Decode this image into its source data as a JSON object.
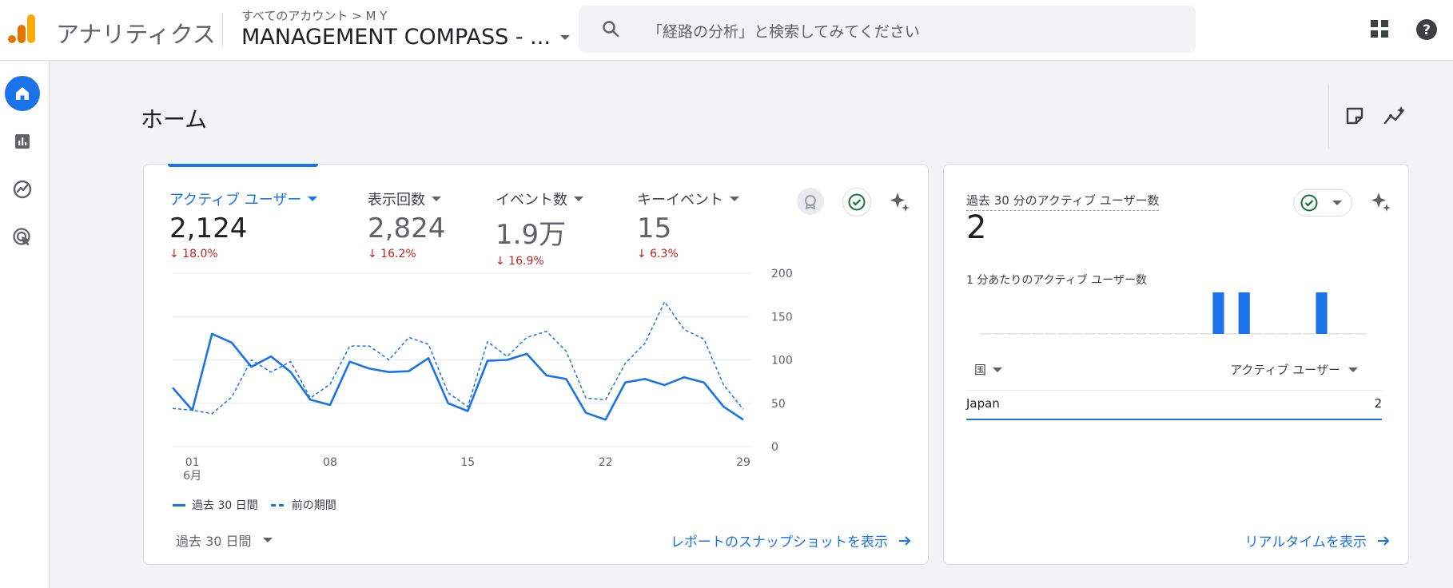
{
  "app": {
    "name": "アナリティクス"
  },
  "header": {
    "breadcrumb": "すべてのアカウント > M Y",
    "property": "MANAGEMENT COMPASS - ...",
    "search_placeholder": "「経路の分析」と検索してみてください"
  },
  "rail": {
    "items": [
      "home-icon",
      "reports-icon",
      "explore-icon",
      "advertising-icon"
    ]
  },
  "page": {
    "title": "ホーム"
  },
  "summary": {
    "metrics": [
      {
        "label": "アクティブ ユーザー",
        "value": "2,124",
        "change": "↓ 18.0%"
      },
      {
        "label": "表示回数",
        "value": "2,824",
        "change": "↓ 16.2%"
      },
      {
        "label": "イベント数",
        "value": "1.9万",
        "change": "↓ 16.9%"
      },
      {
        "label": "キーイベント",
        "value": "15",
        "change": "↓ 6.3%"
      }
    ],
    "legend_current": "過去 30 日間",
    "legend_previous": "前の期間",
    "period": "過去 30 日間",
    "snapshot_link": "レポートのスナップショットを表示"
  },
  "chart_data": {
    "type": "line",
    "x_ticks": [
      {
        "day": 1,
        "label": "01"
      },
      {
        "day": 8,
        "label": "08"
      },
      {
        "day": 15,
        "label": "15"
      },
      {
        "day": 22,
        "label": "22"
      },
      {
        "day": 29,
        "label": "29"
      }
    ],
    "x_month_label": "6月",
    "ylim": [
      0,
      200
    ],
    "y_ticks": [
      0,
      50,
      100,
      150,
      200
    ],
    "series": [
      {
        "name": "過去 30 日間",
        "style": "solid",
        "x": [
          0,
          1,
          2,
          3,
          4,
          5,
          6,
          7,
          8,
          9,
          10,
          11,
          12,
          13,
          14,
          15,
          16,
          17,
          18,
          19,
          20,
          21,
          22,
          23,
          24,
          25,
          26,
          27,
          28,
          29
        ],
        "values": [
          68,
          42,
          130,
          120,
          92,
          104,
          86,
          54,
          48,
          98,
          90,
          86,
          87,
          102,
          50,
          41,
          99,
          100,
          107,
          82,
          78,
          39,
          31,
          74,
          78,
          71,
          80,
          74,
          46,
          31
        ]
      },
      {
        "name": "前の期間",
        "style": "dashed",
        "x": [
          0,
          1,
          2,
          3,
          4,
          5,
          6,
          7,
          8,
          9,
          10,
          11,
          12,
          13,
          14,
          15,
          16,
          17,
          18,
          19,
          20,
          21,
          22,
          23,
          24,
          25,
          26,
          27,
          28,
          29
        ],
        "values": [
          44,
          42,
          38,
          57,
          100,
          86,
          98,
          56,
          72,
          116,
          116,
          100,
          126,
          118,
          62,
          46,
          121,
          104,
          126,
          133,
          110,
          56,
          54,
          96,
          119,
          167,
          135,
          124,
          71,
          43
        ]
      }
    ],
    "colors": {
      "line": "#1a73e8",
      "grid": "#e8eaed"
    }
  },
  "realtime": {
    "title": "過去 30 分のアクティブ ユーザー数",
    "value": "2",
    "sub": "1 分あたりのアクティブ ユーザー数",
    "minute_bars": [
      0,
      0,
      0,
      0,
      0,
      0,
      0,
      0,
      0,
      0,
      0,
      0,
      0,
      0,
      0,
      0,
      0,
      0,
      1,
      0,
      1,
      0,
      0,
      0,
      0,
      0,
      1,
      0,
      0,
      0
    ],
    "col_country": "国",
    "col_users": "アクティブ ユーザー",
    "rows": [
      {
        "country": "Japan",
        "users": "2"
      }
    ],
    "link": "リアルタイムを表示"
  }
}
